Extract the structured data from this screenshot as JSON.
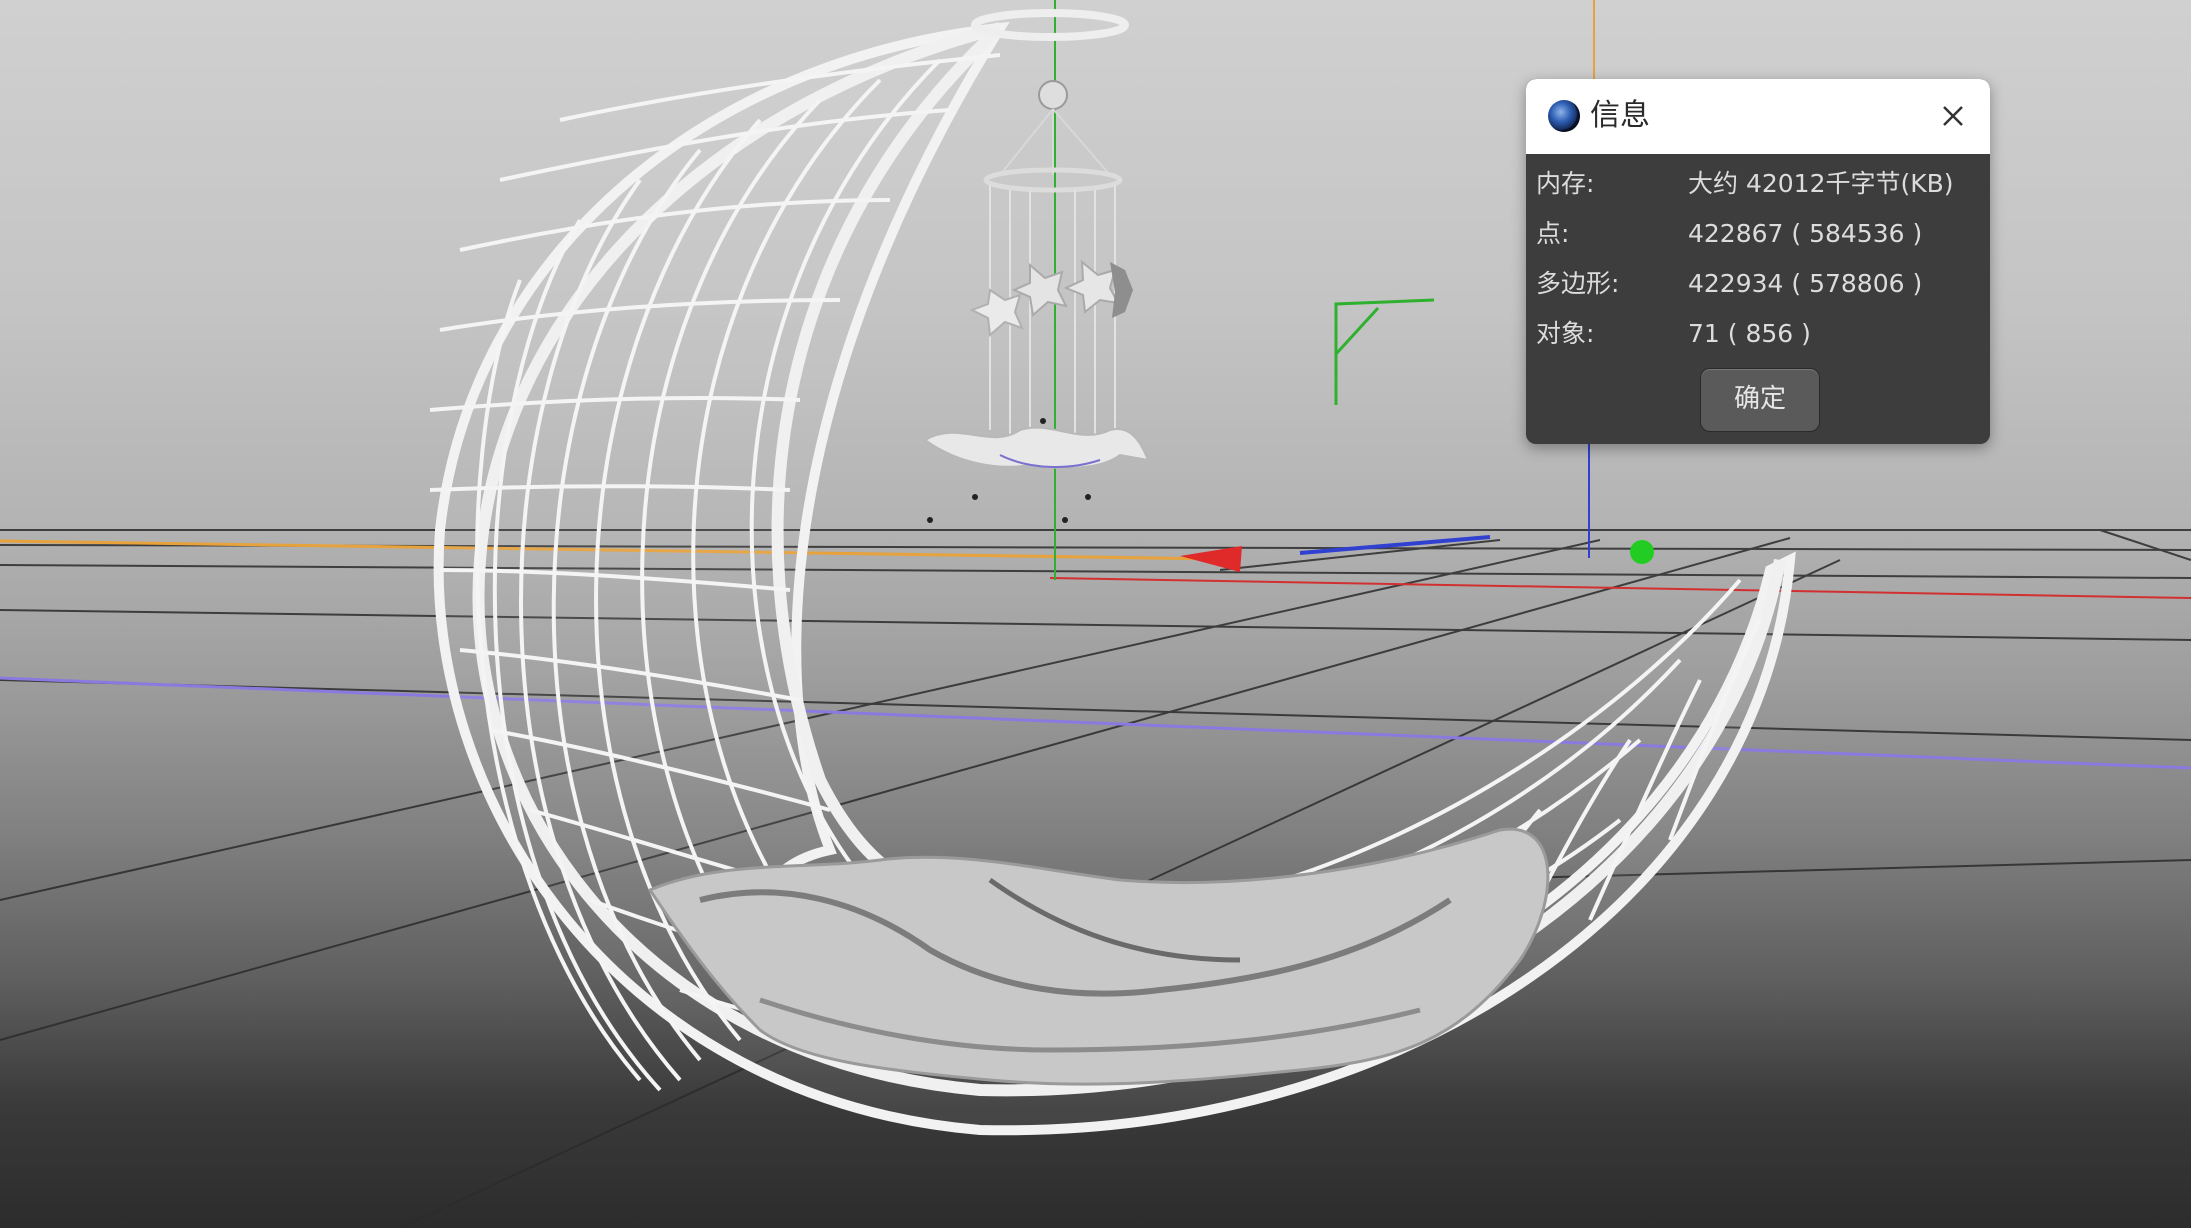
{
  "dialog": {
    "title": "信息",
    "close_icon": "close-icon",
    "app_icon": "cinema4d-logo-icon",
    "rows": [
      {
        "label": "内存:",
        "value": "大约 42012千字节(KB)"
      },
      {
        "label": "点:",
        "value": "422867 ( 584536 )"
      },
      {
        "label": "多边形:",
        "value": "422934 ( 578806 )"
      },
      {
        "label": "对象:",
        "value": "71 ( 856 )"
      }
    ],
    "ok_label": "确定"
  },
  "viewport": {
    "scene": "3d-viewport",
    "colors": {
      "x_axis": "#d23030",
      "y_axis": "#2fb12f",
      "z_axis": "#3040d0",
      "horizon_orange": "#e8a23c",
      "guide_purple": "#8a7ae0",
      "grid": "#2a2a2a"
    }
  }
}
